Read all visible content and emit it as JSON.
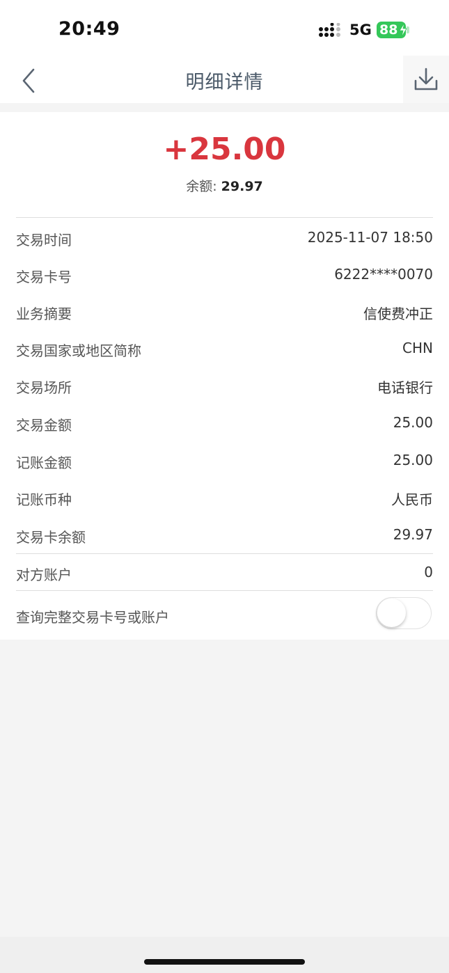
{
  "status_bar": {
    "time": "20:49",
    "network": "5G",
    "battery": "88"
  },
  "nav": {
    "title": "明细详情",
    "back_icon": "chevron-left-icon",
    "download_icon": "download-icon"
  },
  "summary": {
    "amount": "+25.00",
    "balance_label": "余额: ",
    "balance_value": "29.97",
    "amount_color": "#d9363e"
  },
  "details": [
    {
      "label": "交易时间",
      "value": "2025-11-07 18:50"
    },
    {
      "label": "交易卡号",
      "value": "6222****0070"
    },
    {
      "label": "业务摘要",
      "value": "信使费冲正"
    },
    {
      "label": "交易国家或地区简称",
      "value": "CHN"
    },
    {
      "label": "交易场所",
      "value": "电话银行"
    },
    {
      "label": "交易金额",
      "value": "25.00"
    },
    {
      "label": "记账金额",
      "value": "25.00"
    },
    {
      "label": "记账币种",
      "value": "人民币"
    },
    {
      "label": "交易卡余额",
      "value": "29.97"
    },
    {
      "label": "对方账户",
      "value": "0"
    }
  ],
  "toggle": {
    "label": "查询完整交易卡号或账户",
    "on": false
  }
}
